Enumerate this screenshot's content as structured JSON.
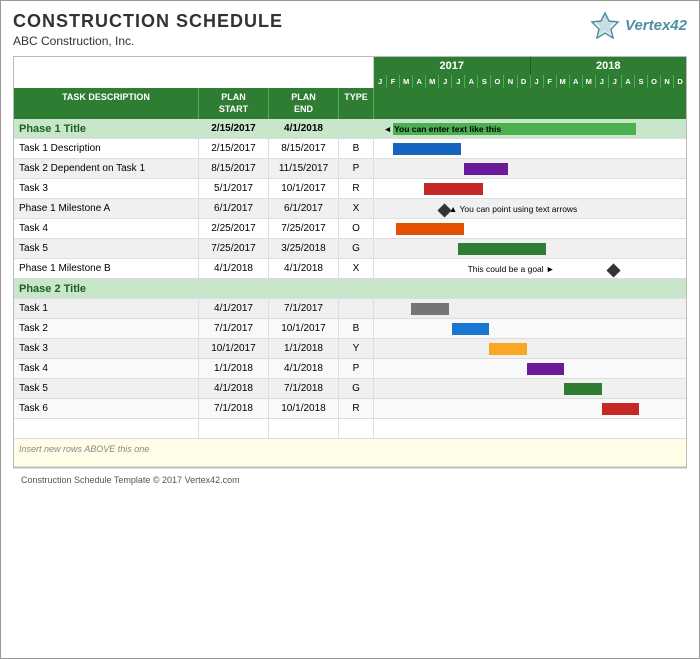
{
  "header": {
    "title": "CONSTRUCTION SCHEDULE",
    "subtitle": "ABC Construction, Inc.",
    "logo_text": "Vertex42",
    "logo_symbol": "✦✦"
  },
  "years": [
    "2017",
    "2018"
  ],
  "months": [
    "J",
    "F",
    "M",
    "A",
    "M",
    "J",
    "J",
    "A",
    "S",
    "O",
    "N",
    "D",
    "J",
    "F",
    "M",
    "A",
    "M",
    "J",
    "J",
    "A",
    "S",
    "O",
    "N",
    "D"
  ],
  "columns": {
    "task": "TASK DESCRIPTION",
    "plan_start": "PLAN START",
    "plan_end": "PLAN END",
    "type": "TYPE"
  },
  "rows": [
    {
      "id": "phase1",
      "type": "phase",
      "desc": "Phase 1 Title",
      "start": "",
      "end": "",
      "kind": ""
    },
    {
      "id": "t1",
      "type": "task",
      "desc": "Task 1 Description",
      "start": "2/15/2017",
      "end": "8/15/2017",
      "kind": "B"
    },
    {
      "id": "t2",
      "type": "task",
      "desc": "Task 2 Dependent on Task 1",
      "start": "8/15/2017",
      "end": "11/15/2017",
      "kind": "P"
    },
    {
      "id": "t3",
      "type": "task",
      "desc": "Task 3",
      "start": "5/1/2017",
      "end": "10/1/2017",
      "kind": "R"
    },
    {
      "id": "m1",
      "type": "task",
      "desc": "Phase 1 Milestone A",
      "start": "6/1/2017",
      "end": "6/1/2017",
      "kind": "X"
    },
    {
      "id": "t4",
      "type": "task",
      "desc": "Task 4",
      "start": "2/25/2017",
      "end": "7/25/2017",
      "kind": "O"
    },
    {
      "id": "t5",
      "type": "task",
      "desc": "Task 5",
      "start": "7/25/2017",
      "end": "3/25/2018",
      "kind": "G"
    },
    {
      "id": "m2",
      "type": "task",
      "desc": "Phase 1 Milestone B",
      "start": "4/1/2018",
      "end": "4/1/2018",
      "kind": "X"
    },
    {
      "id": "phase2",
      "type": "phase",
      "desc": "Phase 2 Title",
      "start": "",
      "end": "",
      "kind": ""
    },
    {
      "id": "p2t1",
      "type": "task",
      "desc": "Task 1",
      "start": "4/1/2017",
      "end": "7/1/2017",
      "kind": ""
    },
    {
      "id": "p2t2",
      "type": "task",
      "desc": "Task 2",
      "start": "7/1/2017",
      "end": "10/1/2017",
      "kind": "B"
    },
    {
      "id": "p2t3",
      "type": "task",
      "desc": "Task 3",
      "start": "10/1/2017",
      "end": "1/1/2018",
      "kind": "Y"
    },
    {
      "id": "p2t4",
      "type": "task",
      "desc": "Task 4",
      "start": "1/1/2018",
      "end": "4/1/2018",
      "kind": "P"
    },
    {
      "id": "p2t5",
      "type": "task",
      "desc": "Task 5",
      "start": "4/1/2018",
      "end": "7/1/2018",
      "kind": "G"
    },
    {
      "id": "p2t6",
      "type": "task",
      "desc": "Task 6",
      "start": "7/1/2018",
      "end": "10/1/2018",
      "kind": "R"
    }
  ],
  "insert_label": "Insert new rows ABOVE this one",
  "copyright": "Construction Schedule Template © 2017 Vertex42.com",
  "chart_labels": {
    "phase1_label": "◄ You can enter text like this",
    "milestone_a_label": "▲ You can point using text arrows",
    "milestone_b_label": "This could be a goal ►"
  }
}
